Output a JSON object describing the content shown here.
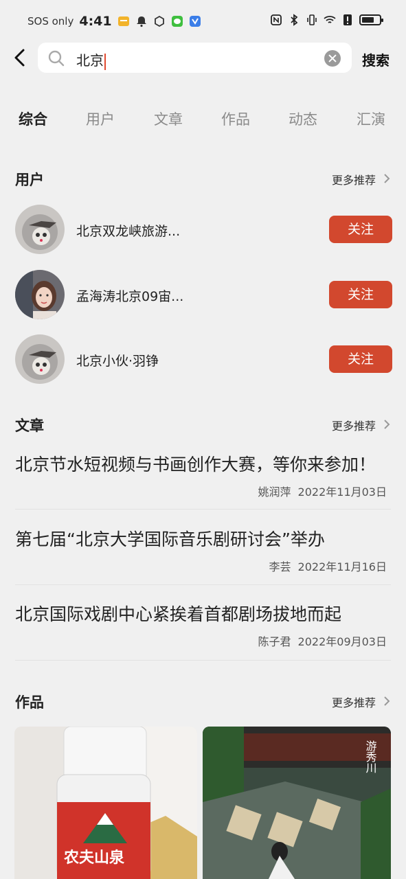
{
  "status_bar": {
    "carrier": "SOS only",
    "time": "4:41",
    "battery_level": 0.7
  },
  "search": {
    "query": "北京",
    "submit_label": "搜索"
  },
  "tabs": [
    {
      "label": "综合",
      "active": true
    },
    {
      "label": "用户",
      "active": false
    },
    {
      "label": "文章",
      "active": false
    },
    {
      "label": "作品",
      "active": false
    },
    {
      "label": "动态",
      "active": false
    },
    {
      "label": "汇演",
      "active": false
    }
  ],
  "users_section": {
    "title": "用户",
    "more_label": "更多推荐",
    "items": [
      {
        "name": "北京双龙峡旅游...",
        "follow_label": "关注",
        "avatar": "cartoon-avatar"
      },
      {
        "name": "孟海涛北京09宙...",
        "follow_label": "关注",
        "avatar": "photo-avatar"
      },
      {
        "name": "北京小伙·羽铮",
        "follow_label": "关注",
        "avatar": "cartoon-avatar"
      }
    ]
  },
  "articles_section": {
    "title": "文章",
    "more_label": "更多推荐",
    "items": [
      {
        "title": "北京节水短视频与书画创作大赛，等你来参加！",
        "author": "姚润萍",
        "date": "2022年11月03日"
      },
      {
        "title": "第七届“北京大学国际音乐剧研讨会”举办",
        "author": "李芸",
        "date": "2022年11月16日"
      },
      {
        "title": "北京国际戏剧中心紧挨着首都剧场拔地而起",
        "author": "陈子君",
        "date": "2022年09月03日"
      }
    ]
  },
  "works_section": {
    "title": "作品",
    "more_label": "更多推荐",
    "items": [
      {
        "thumb": "water-bottle-photo",
        "caption": "农夫山泉"
      },
      {
        "thumb": "courtyard-dance-photo",
        "caption": "游秀川"
      }
    ]
  },
  "colors": {
    "accent": "#d2482e",
    "background": "#f0f0f0"
  }
}
